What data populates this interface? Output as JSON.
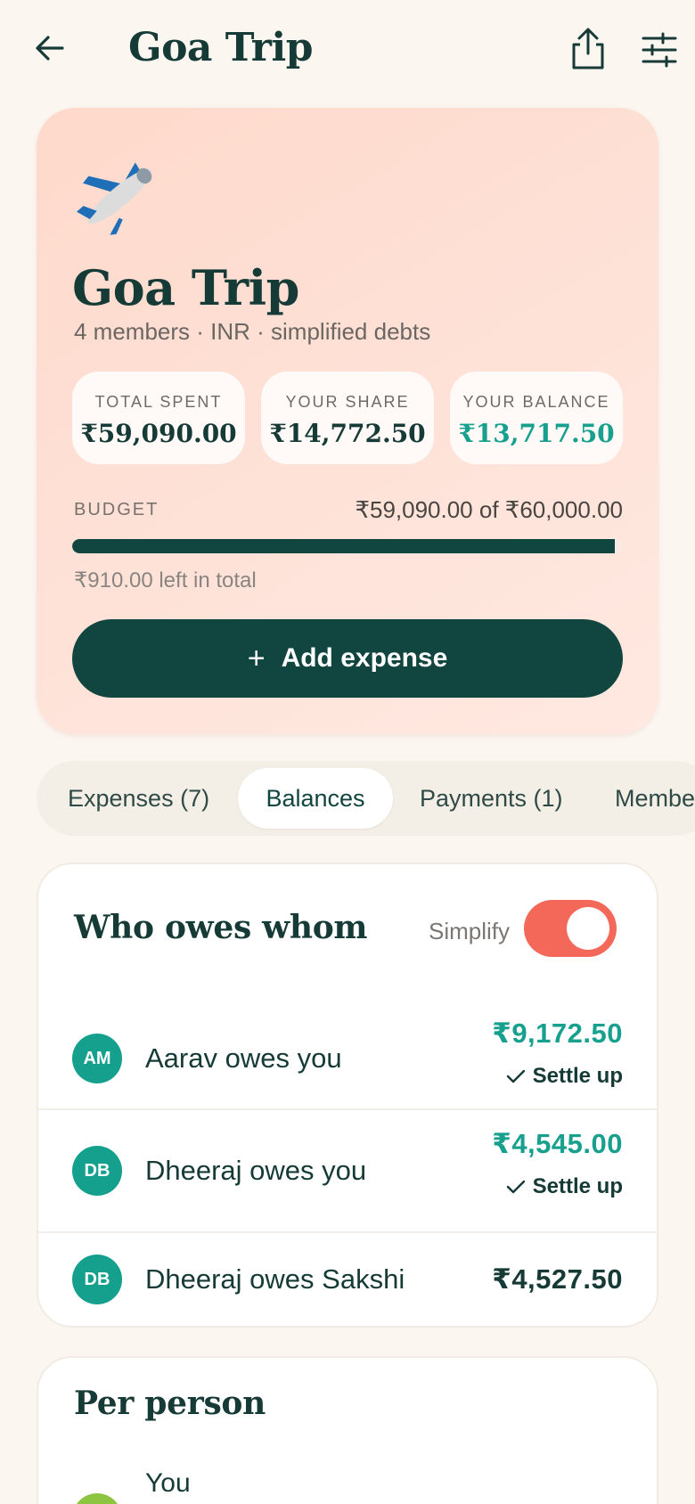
{
  "header": {
    "title": "Goa Trip"
  },
  "hero": {
    "emoji": "✈️",
    "title": "Goa Trip",
    "subtitle": "4 members · INR · simplified debts",
    "stats": [
      {
        "label": "TOTAL SPENT",
        "value": "₹59,090.00"
      },
      {
        "label": "YOUR SHARE",
        "value": "₹14,772.50"
      },
      {
        "label": "YOUR BALANCE",
        "value": "₹13,717.50"
      }
    ],
    "budget": {
      "label": "BUDGET",
      "amount": "₹59,090.00 of ₹60,000.00",
      "progress_percent": 98.5,
      "left_text": "₹910.00 left in total"
    },
    "add_label": "Add expense"
  },
  "tabs": [
    {
      "label": "Expenses (7)",
      "active": false
    },
    {
      "label": "Balances",
      "active": true
    },
    {
      "label": "Payments (1)",
      "active": false
    },
    {
      "label": "Members",
      "active": false
    }
  ],
  "owes": {
    "title": "Who owes whom",
    "simplify_label": "Simplify",
    "simplify_on": true,
    "rows": [
      {
        "initials": "AM",
        "text": "Aarav owes you",
        "amount": "₹9,172.50",
        "action": "Settle up"
      },
      {
        "initials": "DB",
        "text": "Dheeraj owes you",
        "amount": "₹4,545.00",
        "action": "Settle up"
      },
      {
        "initials": "DB",
        "text": "Dheeraj owes Sakshi",
        "amount": "₹4,527.50"
      }
    ]
  },
  "per_person": {
    "title": "Per person",
    "first_name": "You"
  },
  "colors": {
    "primary": "#11453f",
    "teal": "#18a08e",
    "toggle": "#f4685a",
    "hero_bg": "#fed9cb",
    "page_bg": "#fcf6f1"
  },
  "icons": {
    "back": "arrow-left-icon",
    "share": "share-icon",
    "filter": "sliders-icon",
    "check": "check-icon"
  }
}
